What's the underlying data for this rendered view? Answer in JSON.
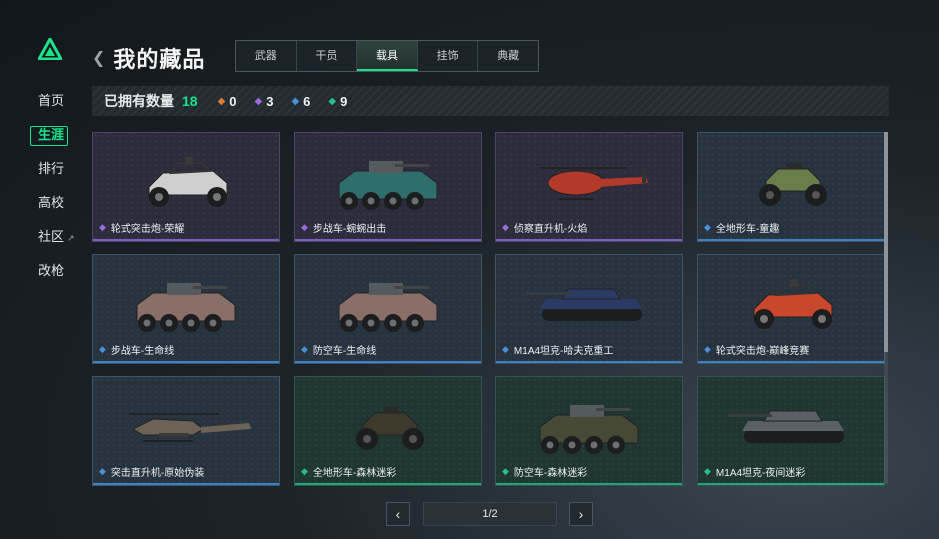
{
  "nav": {
    "items": [
      {
        "label": "首页",
        "active": false,
        "sup": ""
      },
      {
        "label": "生涯",
        "active": true,
        "sup": ""
      },
      {
        "label": "排行",
        "active": false,
        "sup": ""
      },
      {
        "label": "高校",
        "active": false,
        "sup": ""
      },
      {
        "label": "社区",
        "active": false,
        "sup": "↗"
      },
      {
        "label": "改枪",
        "active": false,
        "sup": ""
      }
    ]
  },
  "header": {
    "title": "我的藏品",
    "tabs": [
      {
        "label": "武器",
        "active": false
      },
      {
        "label": "干员",
        "active": false
      },
      {
        "label": "载具",
        "active": true
      },
      {
        "label": "挂饰",
        "active": false
      },
      {
        "label": "典藏",
        "active": false
      }
    ]
  },
  "stats": {
    "label": "已拥有数量",
    "total": "18",
    "by_rarity": [
      {
        "icon": "orange-gem-icon",
        "color": "#e07b39",
        "count": "0"
      },
      {
        "icon": "purple-gem-icon",
        "color": "#9b6bdb",
        "count": "3"
      },
      {
        "icon": "blue-gem-icon",
        "color": "#4a90d9",
        "count": "6"
      },
      {
        "icon": "green-gem-icon",
        "color": "#27c08a",
        "count": "9"
      }
    ]
  },
  "vehicles": [
    {
      "name": "轮式突击炮-荣耀",
      "rarity": "purple",
      "kind": "buggy",
      "paint": "#cfcfcf"
    },
    {
      "name": "步战车-蜿蜿出击",
      "rarity": "purple",
      "kind": "apc",
      "paint": "#2f6e6a"
    },
    {
      "name": "侦察直升机-火焰",
      "rarity": "purple",
      "kind": "heli_small",
      "paint": "#b33a2a"
    },
    {
      "name": "全地形车-童趣",
      "rarity": "blue",
      "kind": "atv",
      "paint": "#6b7d4a"
    },
    {
      "name": "步战车-生命线",
      "rarity": "blue",
      "kind": "apc",
      "paint": "#8a6f68"
    },
    {
      "name": "防空车-生命线",
      "rarity": "blue",
      "kind": "apc",
      "paint": "#8a6f68"
    },
    {
      "name": "M1A4坦克-哈夫克重工",
      "rarity": "blue",
      "kind": "tank",
      "paint": "#2c3a66"
    },
    {
      "name": "轮式突击炮-巅峰竞赛",
      "rarity": "blue",
      "kind": "buggy",
      "paint": "#c9472c"
    },
    {
      "name": "突击直升机-原始伪装",
      "rarity": "blue",
      "kind": "heli_attack",
      "paint": "#6d6256"
    },
    {
      "name": "全地形车-森林迷彩",
      "rarity": "green",
      "kind": "atv",
      "paint": "#3e3a2c"
    },
    {
      "name": "防空车-森林迷彩",
      "rarity": "green",
      "kind": "apc",
      "paint": "#454936"
    },
    {
      "name": "M1A4坦克-夜间迷彩",
      "rarity": "green",
      "kind": "tank",
      "paint": "#5b6066"
    }
  ],
  "rarity_colors": {
    "purple": "#9b6bdb",
    "blue": "#4a90d9",
    "green": "#27c08a"
  },
  "pager": {
    "prev": "‹",
    "indicator": "1/2",
    "next": "›"
  }
}
